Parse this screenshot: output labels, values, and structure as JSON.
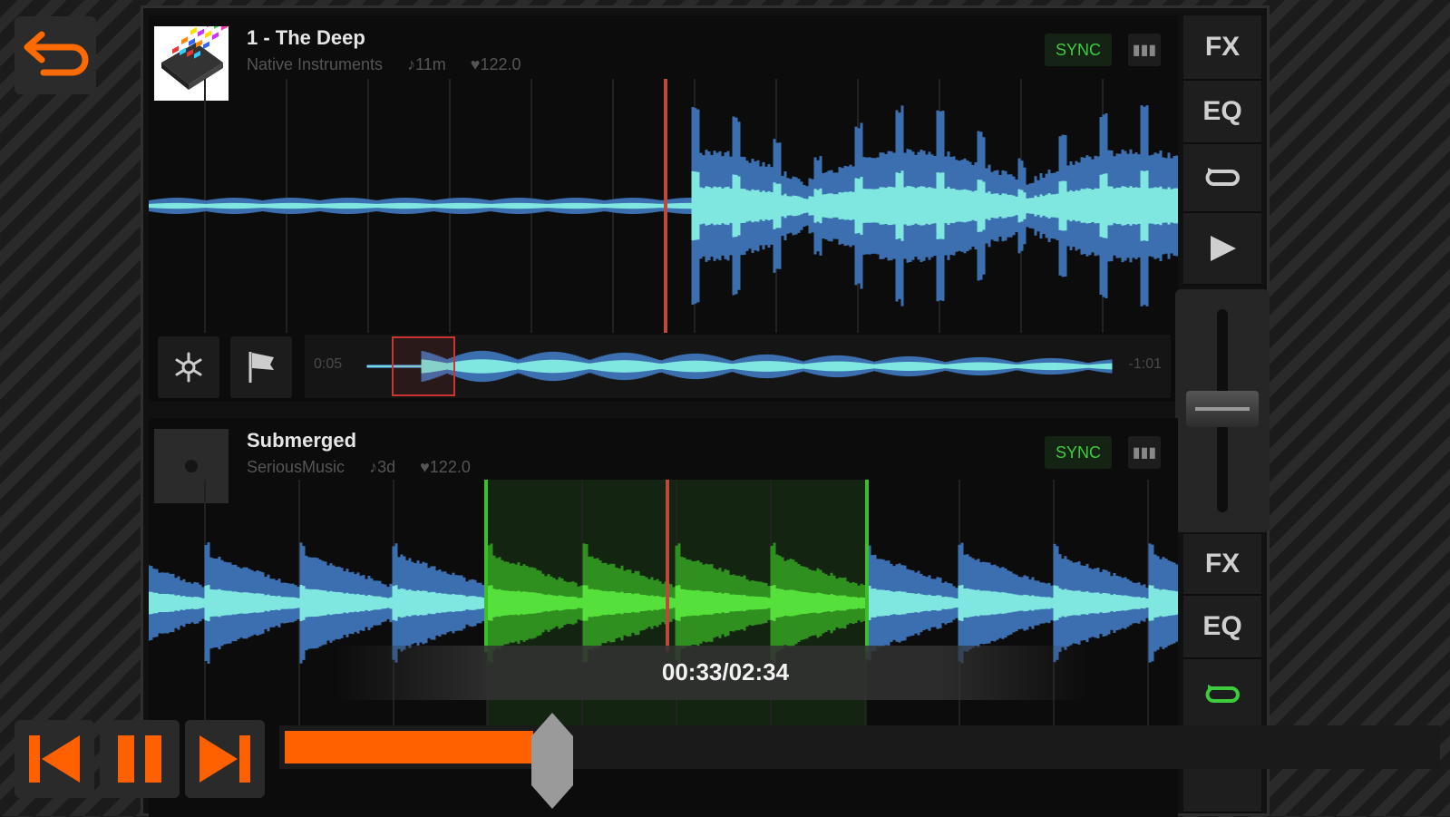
{
  "app": {
    "back_icon": "undo-arrow-icon"
  },
  "deck1": {
    "title": "1 - The Deep",
    "artist": "Native Instruments",
    "duration": "♪11m",
    "bpm": "♥122.0",
    "sync_label": "SYNC",
    "overview_start": "0:05",
    "overview_end": "-1:01",
    "side_buttons": [
      "FX",
      "EQ",
      "loop-icon",
      "play-icon"
    ]
  },
  "deck2": {
    "title": "Submerged",
    "artist": "SeriousMusic",
    "duration": "♪3d",
    "bpm": "♥122.0",
    "sync_label": "SYNC",
    "side_buttons": [
      "FX",
      "EQ",
      "loop-icon"
    ]
  },
  "player": {
    "time": "00:33/02:34",
    "progress": 0.214,
    "colors": {
      "accent": "#ff6000",
      "sync": "#3ccc3c",
      "wave": "#3b6fb0",
      "wave_hi": "#7fe6e0",
      "loop": "#3bbf2a",
      "playhead": "#c0483a"
    }
  }
}
